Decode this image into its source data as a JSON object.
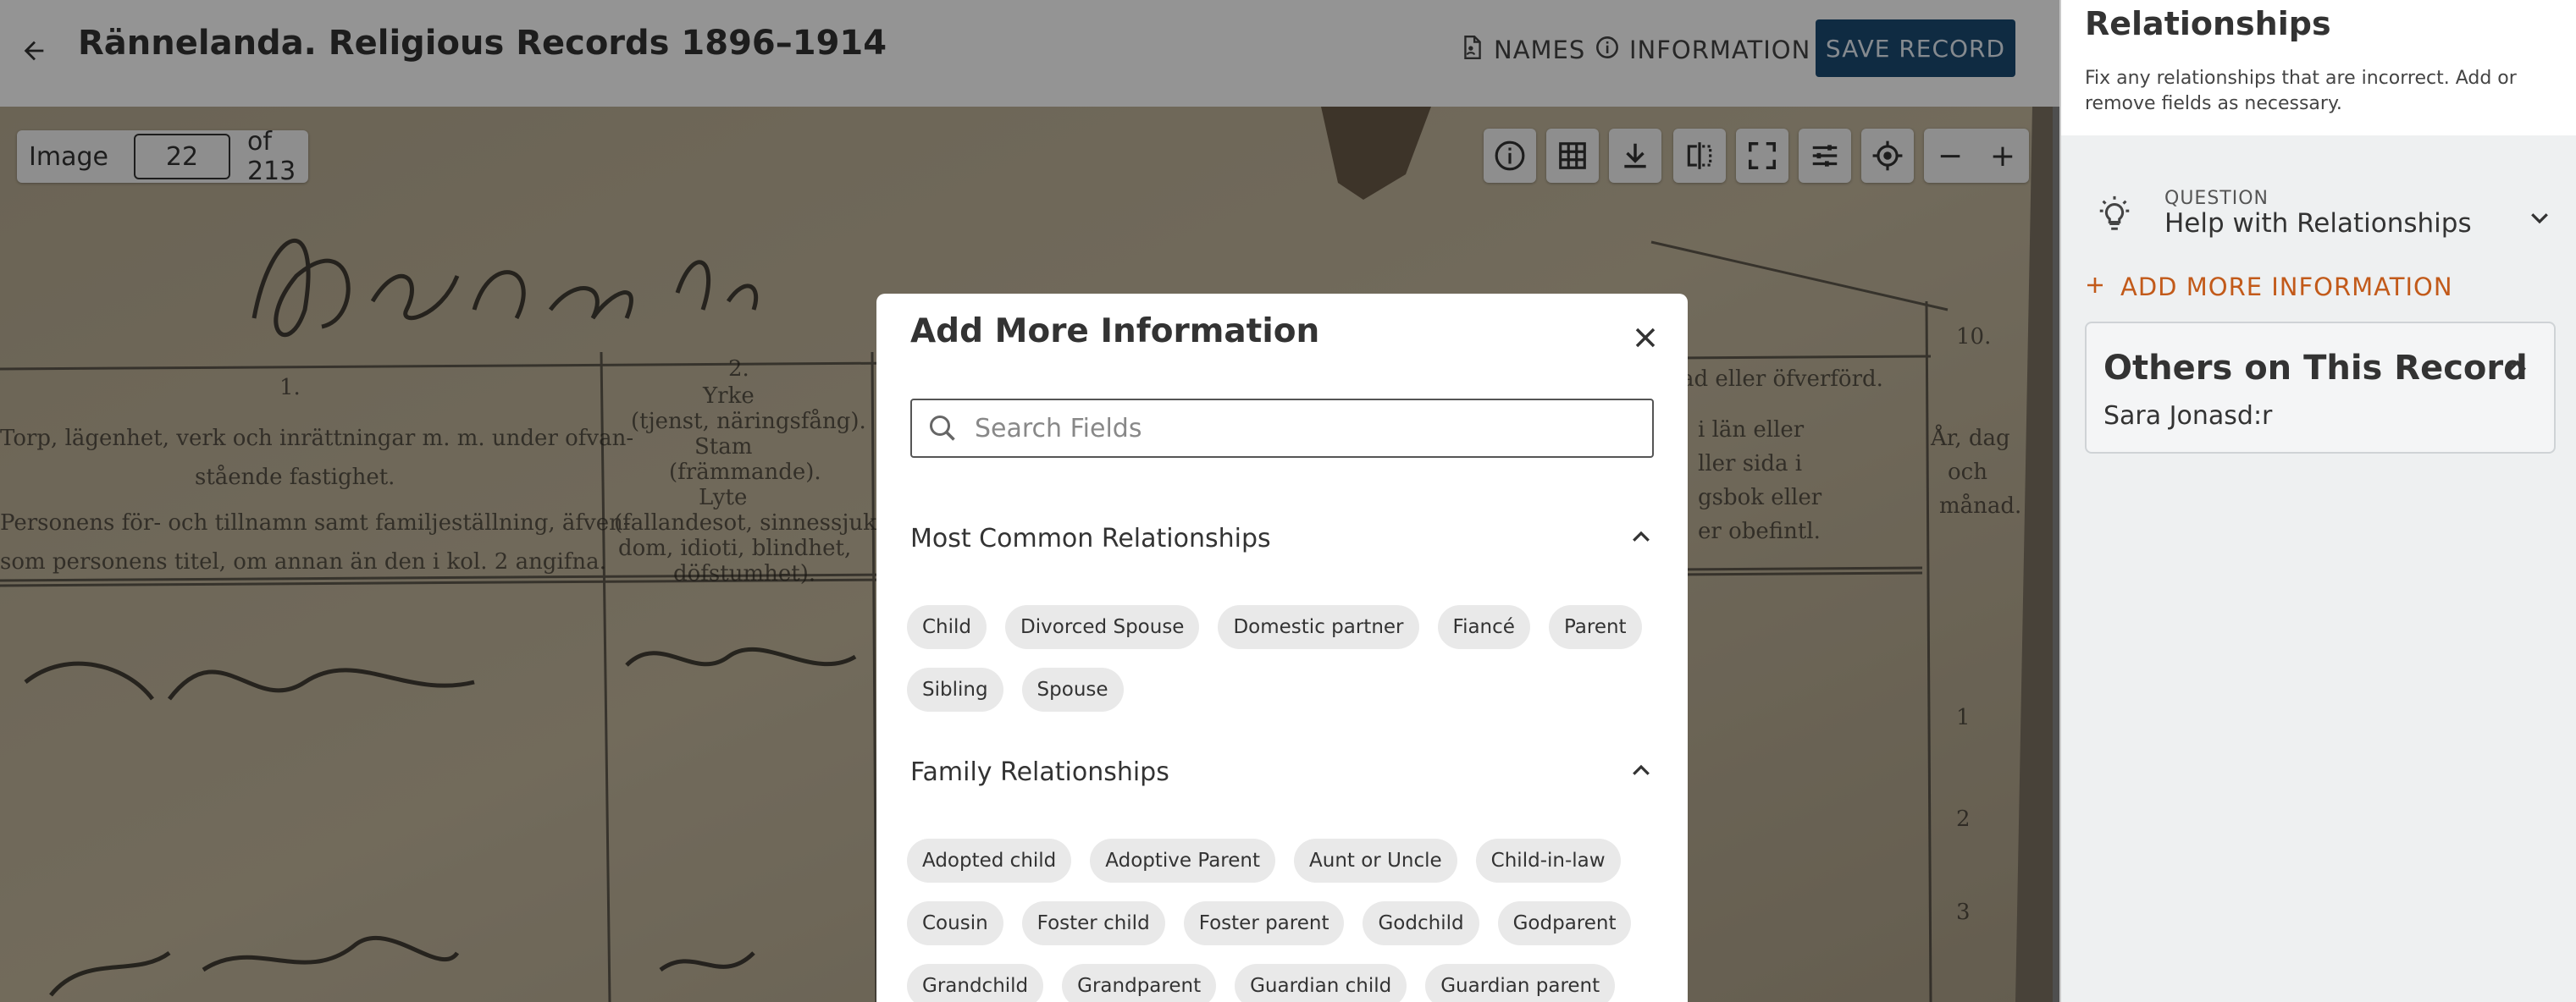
{
  "header": {
    "title": "Rännelanda. Religious Records 1896–1914",
    "names_label": "NAMES",
    "info_label": "INFORMATION",
    "save_label": "SAVE RECORD"
  },
  "viewer": {
    "image_label": "Image",
    "image_number": "22",
    "image_total": "of 213",
    "tools": [
      "info-icon",
      "table-icon",
      "download-icon",
      "compare-icon",
      "fullscreen-icon",
      "adjust-icon",
      "recenter-icon"
    ],
    "zoom_out": "−",
    "zoom_in": "+"
  },
  "modal": {
    "title": "Add More Information",
    "search_placeholder": "Search Fields",
    "sections": [
      {
        "title": "Most Common Relationships",
        "expanded": true,
        "chips": [
          "Child",
          "Divorced Spouse",
          "Domestic partner",
          "Fiancé",
          "Parent",
          "Sibling",
          "Spouse"
        ]
      },
      {
        "title": "Family Relationships",
        "expanded": true,
        "chips": [
          "Adopted child",
          "Adoptive Parent",
          "Aunt or Uncle",
          "Child-in-law",
          "Cousin",
          "Foster child",
          "Foster parent",
          "Godchild",
          "Godparent",
          "Grandchild",
          "Grandparent",
          "Guardian child",
          "Guardian parent"
        ]
      }
    ]
  },
  "right_panel": {
    "title": "Relationships",
    "description": "Fix any relationships that are incorrect. Add or remove fields as necessary.",
    "question_label": "QUESTION",
    "question_text": "Help with Relationships",
    "add_more_label": "ADD MORE INFORMATION",
    "others_title": "Others on This Record",
    "others": [
      "Sara Jonasd:r"
    ]
  },
  "colors": {
    "save_button": "#1a4a73",
    "accent_orange": "#c25a1a",
    "chip_bg": "#e9e9e9"
  }
}
